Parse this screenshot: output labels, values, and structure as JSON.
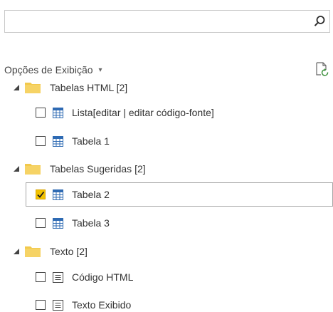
{
  "search": {
    "value": "",
    "placeholder": ""
  },
  "options": {
    "label": "Opções de Exibição",
    "caret": "▾"
  },
  "tree": {
    "folders": [
      {
        "label": "Tabelas HTML [2]",
        "items": [
          {
            "label": "Lista[editar | editar código-fonte]",
            "checked": false,
            "type": "table"
          },
          {
            "label": "Tabela 1",
            "checked": false,
            "type": "table"
          }
        ]
      },
      {
        "label": "Tabelas Sugeridas [2]",
        "items": [
          {
            "label": "Tabela 2",
            "checked": true,
            "type": "table"
          },
          {
            "label": "Tabela 3",
            "checked": false,
            "type": "table"
          }
        ]
      },
      {
        "label": "Texto [2]",
        "items": [
          {
            "label": "Código HTML",
            "checked": false,
            "type": "text"
          },
          {
            "label": "Texto Exibido",
            "checked": false,
            "type": "text"
          }
        ]
      }
    ]
  },
  "colors": {
    "folder": "#f2c94c",
    "folder_dark": "#e6b422",
    "checkbox_checked": "#f2c200",
    "table_icon": "#2e6ab3"
  }
}
